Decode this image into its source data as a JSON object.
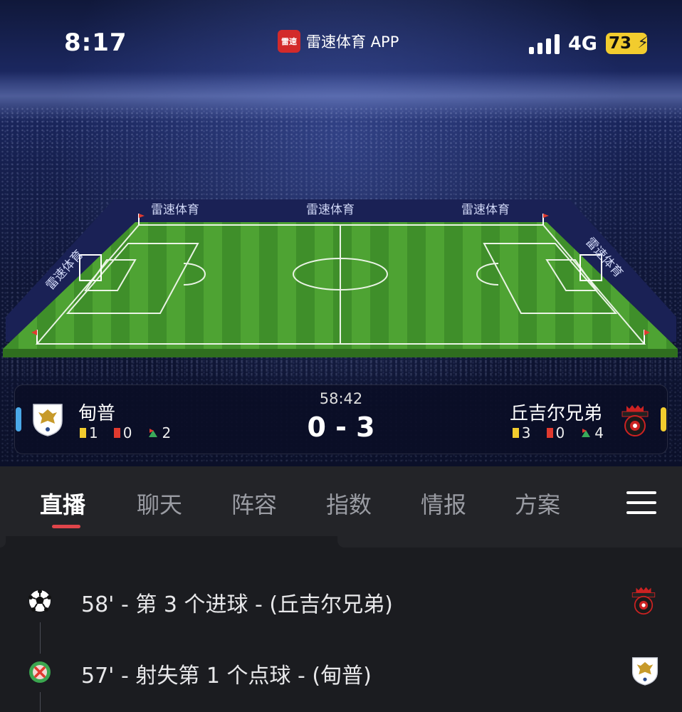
{
  "status_bar": {
    "time": "8:17",
    "app_badge": "雷速",
    "app_title": "雷速体育 APP",
    "network": "4G",
    "battery": "73"
  },
  "pitch": {
    "ad_text": "雷速体育"
  },
  "match": {
    "clock": "58:42",
    "score": "0 - 3",
    "home": {
      "name": "甸普",
      "color": "#4aa8e8",
      "yellow_cards": "1",
      "red_cards": "0",
      "corners": "2"
    },
    "away": {
      "name": "丘吉尔兄弟",
      "color": "#f2cc2e",
      "yellow_cards": "3",
      "red_cards": "0",
      "corners": "4"
    }
  },
  "tabs": [
    {
      "label": "直播",
      "active": true
    },
    {
      "label": "聊天",
      "active": false
    },
    {
      "label": "阵容",
      "active": false
    },
    {
      "label": "指数",
      "active": false
    },
    {
      "label": "情报",
      "active": false
    },
    {
      "label": "方案",
      "active": false
    }
  ],
  "events": [
    {
      "text": "58' - 第 3 个进球 - (丘吉尔兄弟)",
      "icon": "soccer-ball-icon",
      "team": "away"
    },
    {
      "text": "57' - 射失第 1 个点球 - (甸普)",
      "icon": "missed-penalty-icon",
      "team": "home"
    }
  ]
}
